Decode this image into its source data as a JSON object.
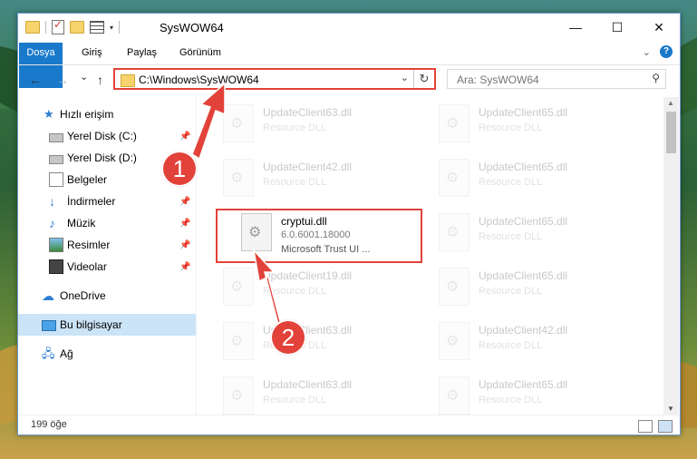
{
  "window": {
    "title": "SysWOW64",
    "controls": {
      "minimize": "—",
      "maximize": "☐",
      "close": "✕"
    }
  },
  "ribbon": {
    "tabs": [
      "Dosya",
      "Giriş",
      "Paylaş",
      "Görünüm"
    ],
    "help": "?"
  },
  "navigation": {
    "back": "←",
    "forward": "→",
    "recent": "⌄",
    "up": "↑",
    "address_path": "C:\\Windows\\SysWOW64",
    "refresh": "↻",
    "search_placeholder": "Ara: SysWOW64"
  },
  "sidebar": {
    "items": [
      {
        "label": "Hızlı erişim",
        "icon": "star-icon",
        "pinned": false
      },
      {
        "label": "Yerel Disk (C:)",
        "icon": "drive-icon",
        "pinned": true
      },
      {
        "label": "Yerel Disk (D:)",
        "icon": "drive-icon",
        "pinned": false
      },
      {
        "label": "Belgeler",
        "icon": "document-icon",
        "pinned": true
      },
      {
        "label": "İndirmeler",
        "icon": "download-icon",
        "pinned": true
      },
      {
        "label": "Müzik",
        "icon": "music-icon",
        "pinned": true
      },
      {
        "label": "Resimler",
        "icon": "pictures-icon",
        "pinned": true
      },
      {
        "label": "Videolar",
        "icon": "videos-icon",
        "pinned": true
      },
      {
        "label": "OneDrive",
        "icon": "cloud-icon",
        "pinned": false
      },
      {
        "label": "Bu bilgisayar",
        "icon": "computer-icon",
        "pinned": false,
        "selected": true
      },
      {
        "label": "Ağ",
        "icon": "network-icon",
        "pinned": false
      }
    ]
  },
  "files": {
    "left_column": [
      {
        "name": "UpdateClient63.dll",
        "desc": "Resource DLL"
      },
      {
        "name": "UpdateClient42.dll",
        "desc": "Resource DLL"
      },
      {
        "name": "cryptui.dll",
        "version": "6.0.6001.18000",
        "company": "Microsoft Trust UI ...",
        "highlighted": true
      },
      {
        "name": "UpdateClient19.dll",
        "desc": "Resource DLL"
      },
      {
        "name": "UpdateClient63.dll",
        "desc": "Resource DLL"
      },
      {
        "name": "UpdateClient63.dll",
        "desc": "Resource DLL"
      }
    ],
    "right_column": [
      {
        "name": "UpdateClient65.dll",
        "desc": "Resource DLL"
      },
      {
        "name": "UpdateClient65.dll",
        "desc": "Resource DLL"
      },
      {
        "name": "UpdateClient65.dll",
        "desc": "Resource DLL"
      },
      {
        "name": "UpdateClient65.dll",
        "desc": "Resource DLL"
      },
      {
        "name": "UpdateClient42.dll",
        "desc": "Resource DLL"
      },
      {
        "name": "UpdateClient65.dll",
        "desc": "Resource DLL"
      }
    ]
  },
  "status": {
    "item_count": "199 öğe"
  },
  "annotations": {
    "step1": "1",
    "step2": "2",
    "color": "#e2423a"
  }
}
